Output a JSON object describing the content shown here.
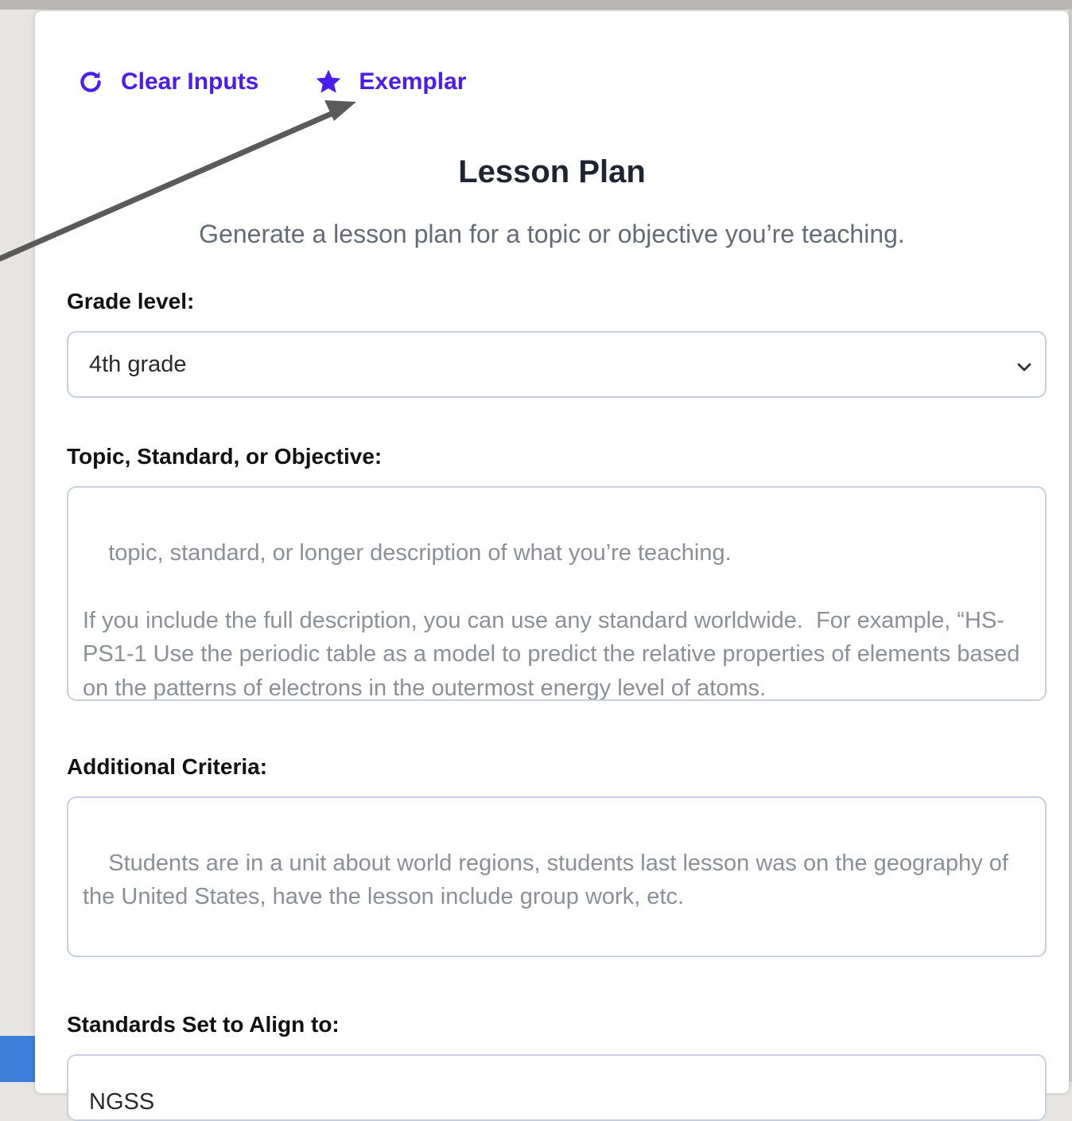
{
  "toolbar": {
    "clear_label": "Clear Inputs",
    "exemplar_label": "Exemplar"
  },
  "header": {
    "title": "Lesson Plan",
    "subtitle": "Generate a lesson plan for a topic or objective you’re teaching."
  },
  "form": {
    "grade": {
      "label": "Grade level:",
      "value": "4th grade"
    },
    "topic": {
      "label": "Topic, Standard, or Objective:",
      "placeholder": "topic, standard, or longer description of what you’re teaching.\n\nIf you include the full description, you can use any standard worldwide.  For example, “HS-PS1-1 Use the periodic table as a model to predict the relative properties of elements based on the patterns of electrons in the outermost energy level of atoms."
    },
    "criteria": {
      "label": "Additional Criteria:",
      "placeholder": "Students are in a unit about world regions, students last lesson was on the geography of the United States, have the lesson include group work, etc."
    },
    "standards": {
      "label": "Standards Set to Align to:",
      "value": "NGSS"
    }
  },
  "colors": {
    "accent": "#4a1cf0",
    "border": "#c7cfe0",
    "annotation_arrow": "#5a5a5a"
  }
}
